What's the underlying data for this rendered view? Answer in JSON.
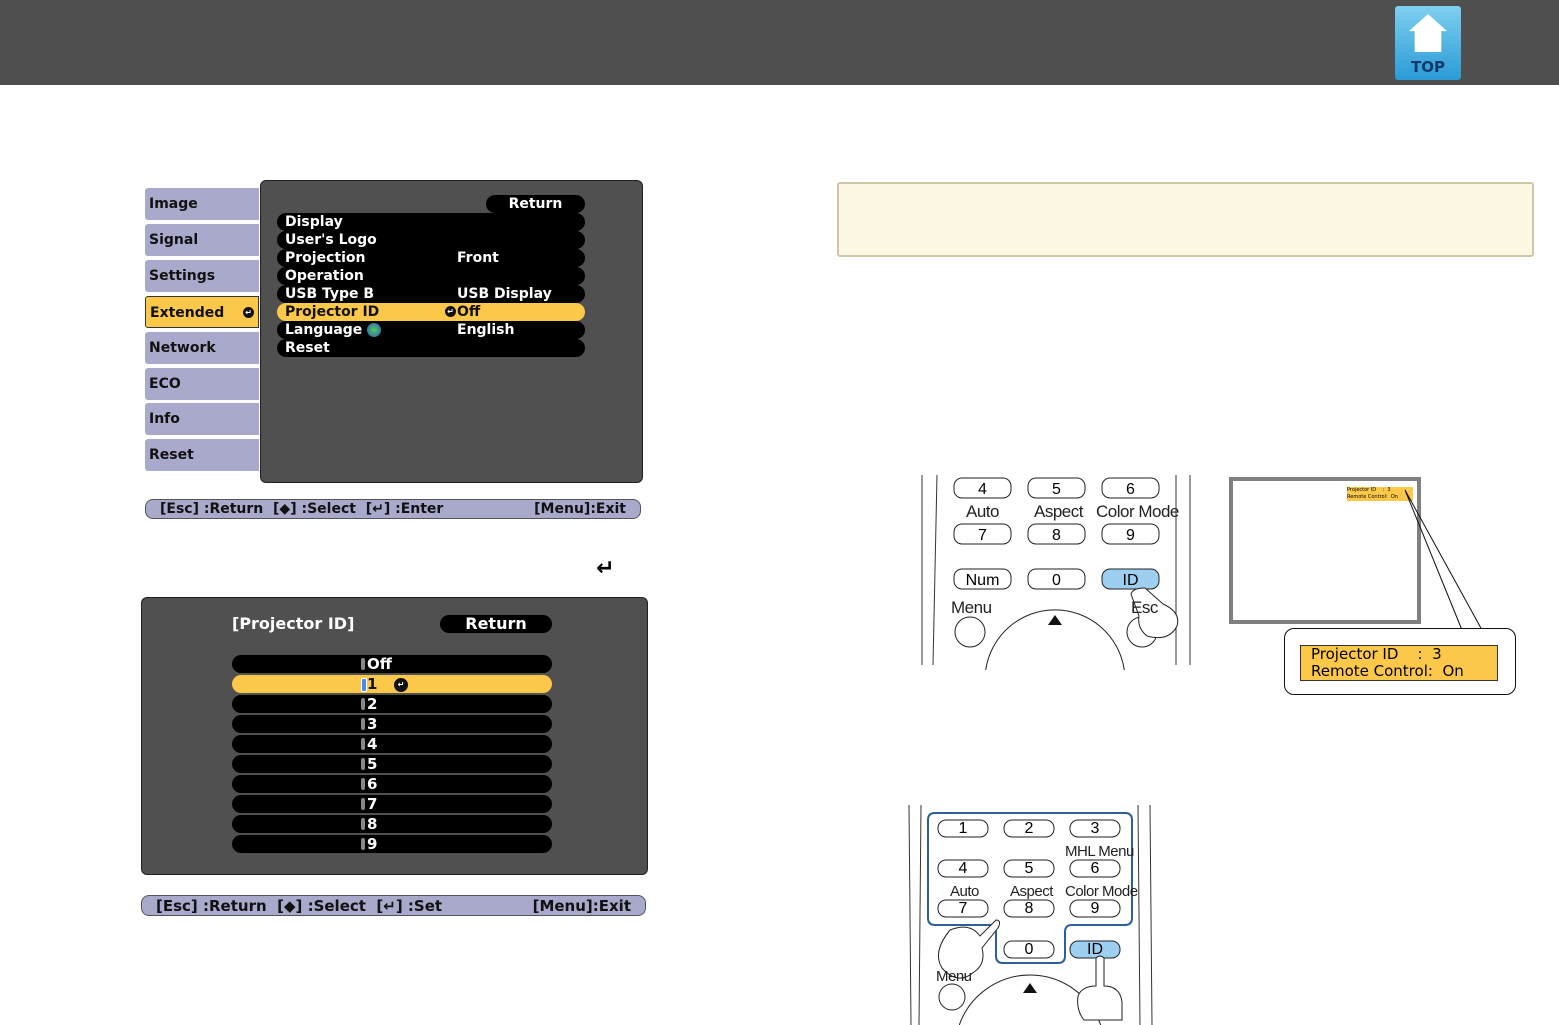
{
  "header": {
    "top_label": "TOP"
  },
  "menu1": {
    "tabs": [
      "Image",
      "Signal",
      "Settings",
      "Extended",
      "Network",
      "ECO",
      "Info",
      "Reset"
    ],
    "selected_tab": 3,
    "return_label": "Return",
    "items": [
      {
        "label": "Display",
        "value": ""
      },
      {
        "label": "User's Logo",
        "value": ""
      },
      {
        "label": "Projection",
        "value": "Front"
      },
      {
        "label": "Operation",
        "value": ""
      },
      {
        "label": "USB Type B",
        "value": "USB Display"
      },
      {
        "label": "Projector ID",
        "value": "Off"
      },
      {
        "label": "Language",
        "value": "English"
      },
      {
        "label": "Reset",
        "value": ""
      }
    ],
    "selected_item": 5,
    "footer": {
      "esc": "[Esc] :Return",
      "select": "[◆] :Select",
      "enter": "[↵] :Enter",
      "menu": "[Menu]:Exit"
    }
  },
  "menu2": {
    "title": "[Projector ID]",
    "return_label": "Return",
    "options": [
      "Off",
      "1",
      "2",
      "3",
      "4",
      "5",
      "6",
      "7",
      "8",
      "9"
    ],
    "selected": 1,
    "footer": {
      "esc": "[Esc] :Return",
      "select": "[◆] :Select",
      "enter": "[↵] :Set",
      "menu": "[Menu]:Exit"
    }
  },
  "remote1": {
    "keys": [
      "4",
      "5",
      "6",
      "7",
      "8",
      "9",
      "Num",
      "0",
      "ID"
    ],
    "labels": [
      "Auto",
      "Aspect",
      "Color Mode",
      "Menu",
      "Esc"
    ]
  },
  "screen": {
    "line1": "Projector ID    :  3",
    "line2": "Remote Control:  On"
  },
  "remote2": {
    "keys": [
      "1",
      "2",
      "3",
      "4",
      "5",
      "6",
      "7",
      "8",
      "9",
      "0",
      "ID"
    ],
    "labels": [
      "MHL Menu",
      "Auto",
      "Aspect",
      "Color Mode",
      "Menu"
    ]
  },
  "colors": {
    "accent": "#fcc84a",
    "menu_bg": "#505050",
    "tab_bg": "#a9a9cc",
    "id_key": "#9dd0f0"
  }
}
